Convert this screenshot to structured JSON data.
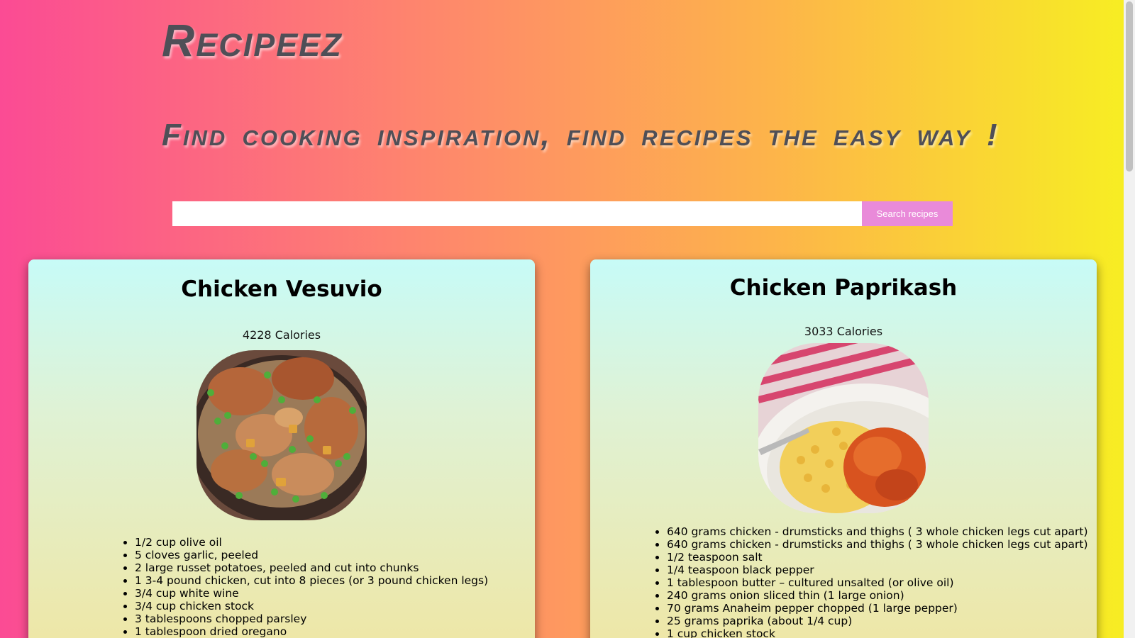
{
  "header": {
    "brand": "Recipeez",
    "tagline": "Find cooking inspiration, find recipes the easy way !"
  },
  "search": {
    "value": "",
    "placeholder": "",
    "button_label": "Search recipes"
  },
  "recipes": [
    {
      "title": "Chicken Vesuvio",
      "calories": "4228 Calories",
      "image_icon": "chicken-vesuvio-photo",
      "ingredients": [
        "1/2 cup olive oil",
        "5 cloves garlic, peeled",
        "2 large russet potatoes, peeled and cut into chunks",
        "1 3-4 pound chicken, cut into 8 pieces (or 3 pound chicken legs)",
        "3/4 cup white wine",
        "3/4 cup chicken stock",
        "3 tablespoons chopped parsley",
        "1 tablespoon dried oregano"
      ]
    },
    {
      "title": "Chicken Paprikash",
      "calories": "3033 Calories",
      "image_icon": "chicken-paprikash-photo",
      "ingredients": [
        "640 grams chicken - drumsticks and thighs ( 3 whole chicken legs cut apart)",
        "640 grams chicken - drumsticks and thighs ( 3 whole chicken legs cut apart)",
        "1/2 teaspoon salt",
        "1/4 teaspoon black pepper",
        "1 tablespoon butter – cultured unsalted (or olive oil)",
        "240 grams onion sliced thin (1 large onion)",
        "70 grams Anaheim pepper chopped (1 large pepper)",
        "25 grams paprika (about 1/4 cup)",
        "1 cup chicken stock"
      ]
    }
  ],
  "colors": {
    "bg_gradient": [
      "#fb4b94",
      "#fe8a6a",
      "#fdb44a",
      "#f7ef22"
    ],
    "text_heading": "#4f4f57",
    "button_bg": "#e98ad9",
    "card_gradient": [
      "#c7fbf7",
      "#dff2d5",
      "#efe6a4"
    ]
  }
}
